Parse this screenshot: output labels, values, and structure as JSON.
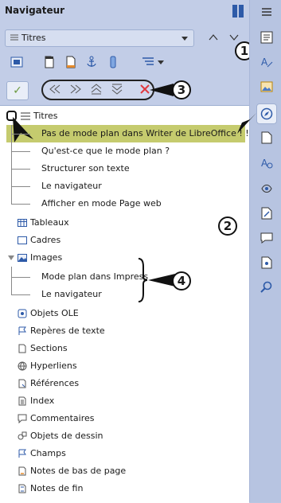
{
  "panel": {
    "title": "Navigateur"
  },
  "combo": {
    "value": "Titres"
  },
  "tree": {
    "root": "Titres",
    "headings": [
      "Pas de mode plan dans Writer de LibreOffice ! !!",
      "Qu'est-ce que le mode plan ?",
      "Structurer son texte",
      "Le navigateur",
      "Afficher en mode Page web"
    ],
    "categories_top": [
      "Tableaux",
      "Cadres"
    ],
    "images": {
      "label": "Images",
      "children": [
        "Mode plan dans Impress",
        "Le navigateur"
      ]
    },
    "categories_bottom": [
      "Objets OLE",
      "Repères de texte",
      "Sections",
      "Hyperliens",
      "Références",
      "Index",
      "Commentaires",
      "Objets de dessin",
      "Champs",
      "Notes de bas de page",
      "Notes de fin"
    ]
  },
  "callouts": [
    "1",
    "2",
    "3",
    "4"
  ],
  "colors": {
    "highlight": "#c5cb6e",
    "panel_bg": "#c2cde7",
    "accent_blue": "#2d5aa8",
    "delete_red": "#e0393e"
  }
}
